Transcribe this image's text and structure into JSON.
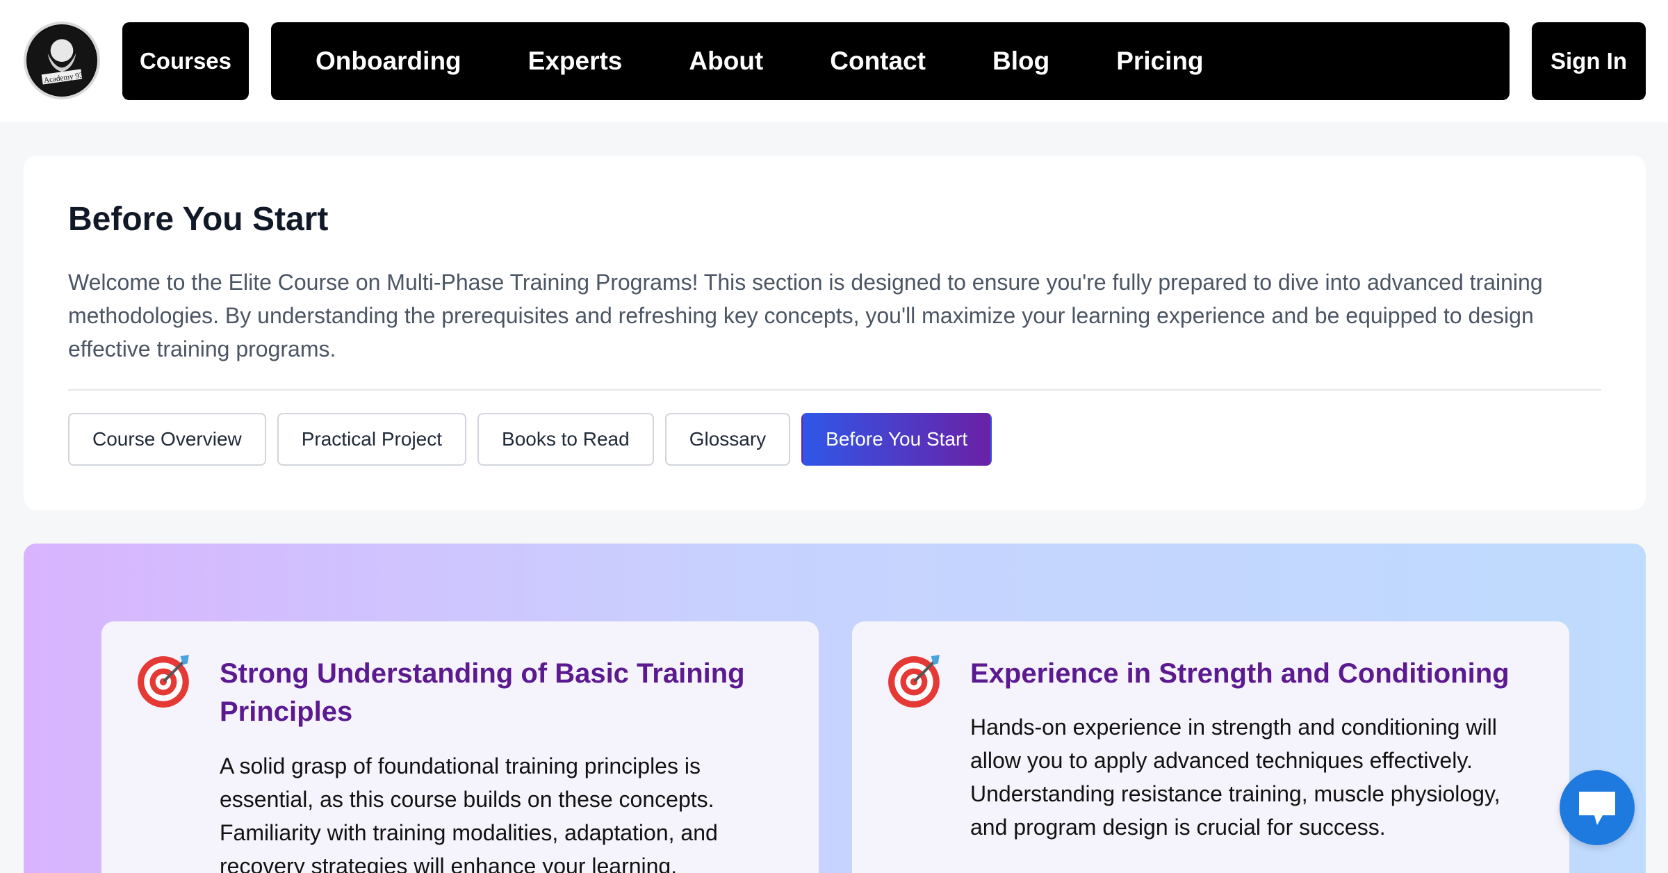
{
  "header": {
    "logo_text": "Academy 93",
    "courses_label": "Courses",
    "nav": [
      "Onboarding",
      "Experts",
      "About",
      "Contact",
      "Blog",
      "Pricing"
    ],
    "signin_label": "Sign In"
  },
  "intro": {
    "title": "Before You Start",
    "text": "Welcome to the Elite Course on Multi-Phase Training Programs! This section is designed to ensure you're fully prepared to dive into advanced training methodologies. By understanding the prerequisites and refreshing key concepts, you'll maximize your learning experience and be equipped to design effective training programs.",
    "tabs": [
      "Course Overview",
      "Practical Project",
      "Books to Read",
      "Glossary",
      "Before You Start"
    ],
    "active_tab": "Before You Start"
  },
  "prerequisites": [
    {
      "icon": "target-dart-icon",
      "title": "Strong Understanding of Basic Training Principles",
      "text": "A solid grasp of foundational training principles is essential, as this course builds on these concepts. Familiarity with training modalities, adaptation, and recovery strategies will enhance your learning."
    },
    {
      "icon": "target-dart-icon",
      "title": "Experience in Strength and Conditioning",
      "text": "Hands-on experience in strength and conditioning will allow you to apply advanced techniques effectively. Understanding resistance training, muscle physiology, and program design is crucial for success."
    }
  ],
  "colors": {
    "nav_bg": "#000000",
    "title_purple": "#5b1a8f",
    "active_tab_start": "#2f57e8",
    "active_tab_end": "#6a21a6",
    "chat_blue": "#1f7ae0"
  }
}
